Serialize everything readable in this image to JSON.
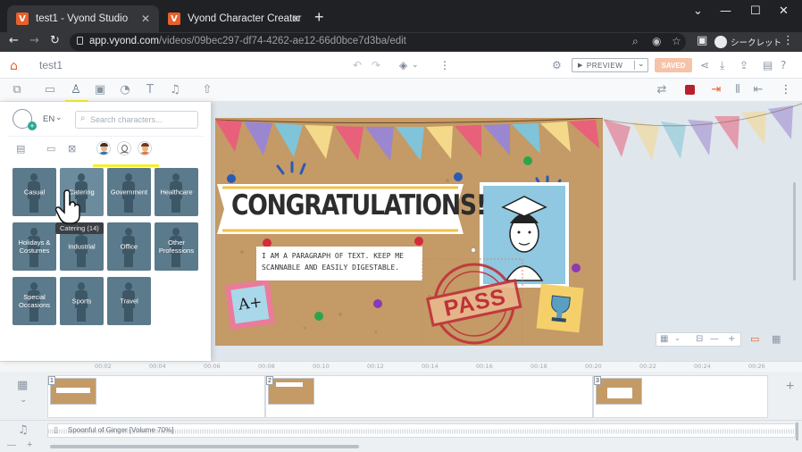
{
  "browser": {
    "tabs": [
      {
        "title": "test1 - Vyond Studio",
        "active": true
      },
      {
        "title": "Vyond Character Creator",
        "active": false
      }
    ],
    "favicon_letter": "V",
    "url_host": "app.vyond.com",
    "url_path": "/videos/09bec297-df74-4262-ae12-66d0bce7d3ba/edit",
    "profile_label": "シークレット"
  },
  "app": {
    "video_name": "test1",
    "preview_label": "PREVIEW",
    "saved_label": "SAVED"
  },
  "character_panel": {
    "language": "EN",
    "search_placeholder": "Search characters...",
    "categories": [
      {
        "label": "Casual"
      },
      {
        "label": "Catering"
      },
      {
        "label": "Government"
      },
      {
        "label": "Healthcare"
      },
      {
        "label": "Holidays & Costumes"
      },
      {
        "label": "Industrial"
      },
      {
        "label": "Office"
      },
      {
        "label": "Other Professions"
      },
      {
        "label": "Special Occasions"
      },
      {
        "label": "Sports"
      },
      {
        "label": "Travel"
      }
    ],
    "tooltip": "Catering (14)"
  },
  "canvas": {
    "headline": "CONGRATULATIONS!",
    "paragraph_line1": "I AM A PARAGRAPH OF TEXT. KEEP ME",
    "paragraph_line2": "SCANNABLE AND EASILY DIGESTABLE.",
    "stamp_text": "PASS",
    "sticky_text": "A+"
  },
  "timeline": {
    "ruler_labels": [
      "00:02",
      "00:04",
      "00:06",
      "00:08",
      "00:10",
      "00:12",
      "00:14",
      "00:16",
      "00:18",
      "00:20",
      "00:22",
      "00:24",
      "00:26"
    ],
    "scenes": [
      "1",
      "2",
      "3"
    ],
    "audio_label": "Spoonful of Ginger [Volume 70%]"
  },
  "colors": {
    "accent": "#e8602c",
    "highlight": "#f4f02d",
    "category_tile": "#5b7a8c",
    "board": "#c49a66",
    "stage_bg": "#dfe6ec"
  }
}
